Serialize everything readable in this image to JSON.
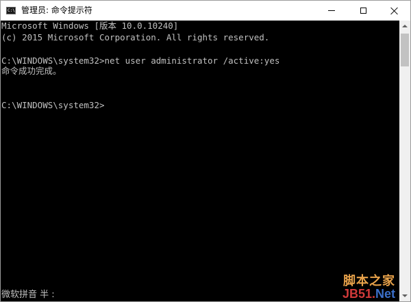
{
  "window": {
    "title": "管理员: 命令提示符",
    "icon": "cmd-icon",
    "icon_glyph": "C:\\"
  },
  "console": {
    "lines": [
      "Microsoft Windows [版本 10.0.10240]",
      "(c) 2015 Microsoft Corporation. All rights reserved.",
      "",
      "C:\\WINDOWS\\system32>net user administrator /active:yes",
      "命令成功完成。",
      "",
      "",
      "C:\\WINDOWS\\system32>"
    ],
    "ime_status": "微软拼音 半 :"
  },
  "watermark": {
    "top": "脚本之家",
    "site": "JB51",
    "dot": ".",
    "tld": "Net"
  },
  "colors": {
    "console_bg": "#000000",
    "console_fg": "#c0c0c0",
    "titlebar_bg": "#ffffff"
  }
}
